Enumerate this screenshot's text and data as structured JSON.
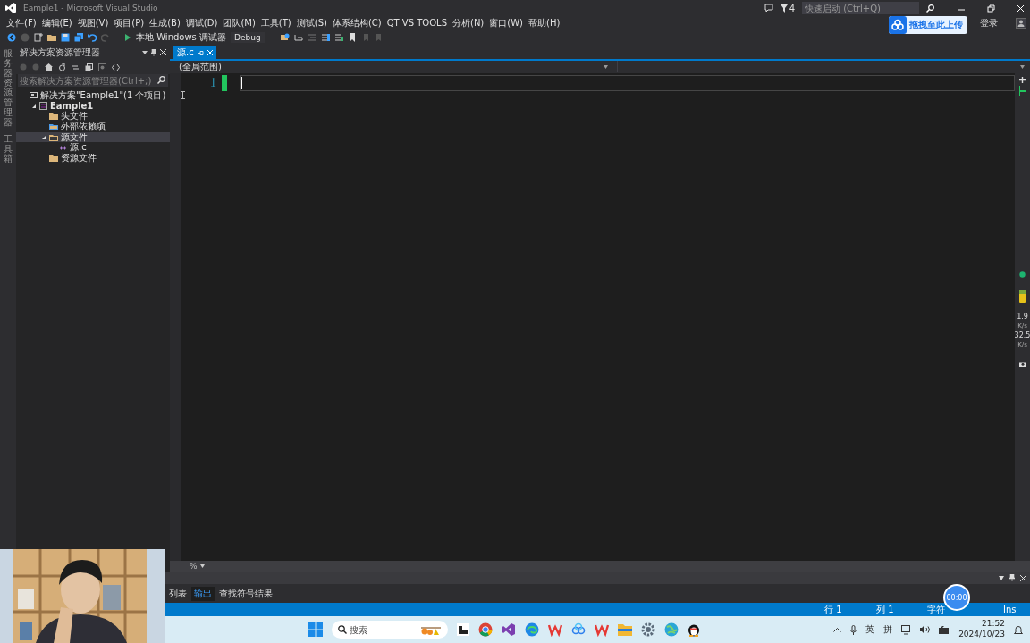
{
  "window": {
    "title": "Eample1 - Microsoft Visual Studio",
    "notification_count": "4",
    "quick_launch": {
      "placeholder": "快速启动 (Ctrl+Q)"
    },
    "sign_in": "登录"
  },
  "menu": [
    "文件(F)",
    "编辑(E)",
    "视图(V)",
    "项目(P)",
    "生成(B)",
    "调试(D)",
    "团队(M)",
    "工具(T)",
    "测试(S)",
    "体系结构(C)",
    "QT VS TOOLS",
    "分析(N)",
    "窗口(W)",
    "帮助(H)"
  ],
  "toolbar": {
    "debugger": "本地 Windows 调试器",
    "configuration": "Debug"
  },
  "upload_widget": {
    "label": "拖拽至此上传"
  },
  "side_strip": [
    "服务器资源管理器",
    "工具箱"
  ],
  "solution_explorer": {
    "title": "解决方案资源管理器",
    "search": {
      "placeholder": "搜索解决方案资源管理器(Ctrl+;)"
    },
    "tree": [
      {
        "label": "解决方案\"Eample1\"(1 个项目)",
        "kind": "solution",
        "selected": false,
        "children": [
          {
            "label": "Eample1",
            "kind": "project",
            "selected": false,
            "expanded": true,
            "children": [
              {
                "label": "头文件",
                "kind": "folder",
                "selected": false
              },
              {
                "label": "外部依赖项",
                "kind": "deps",
                "selected": false
              },
              {
                "label": "源文件",
                "kind": "folder",
                "selected": true,
                "expanded": true,
                "children": [
                  {
                    "label": "源.c",
                    "kind": "file",
                    "selected": false
                  }
                ]
              },
              {
                "label": "资源文件",
                "kind": "folder",
                "selected": false
              }
            ]
          }
        ]
      }
    ]
  },
  "editor": {
    "tabs": [
      {
        "label": "源.c",
        "selected": true
      }
    ],
    "scope": "(全局范围)",
    "lines": [
      {
        "number": "1",
        "changed": true
      }
    ],
    "zoom": "%"
  },
  "side_meters": [
    {
      "value": "1.9",
      "unit": "K/s"
    },
    {
      "value": "32.5",
      "unit": "K/s"
    }
  ],
  "output_panel": {
    "tabs": [
      {
        "label": "列表",
        "selected": false
      },
      {
        "label": "输出",
        "selected": true
      },
      {
        "label": "查找符号结果",
        "selected": false
      }
    ]
  },
  "status_bar": [
    "行 1",
    "列 1",
    "字符",
    "Ins"
  ],
  "recording_timer": "00:00",
  "taskbar": {
    "search": {
      "placeholder": "搜索"
    },
    "tray": [
      "英",
      "拼"
    ],
    "time": "21:52",
    "date": "2024/10/23"
  }
}
